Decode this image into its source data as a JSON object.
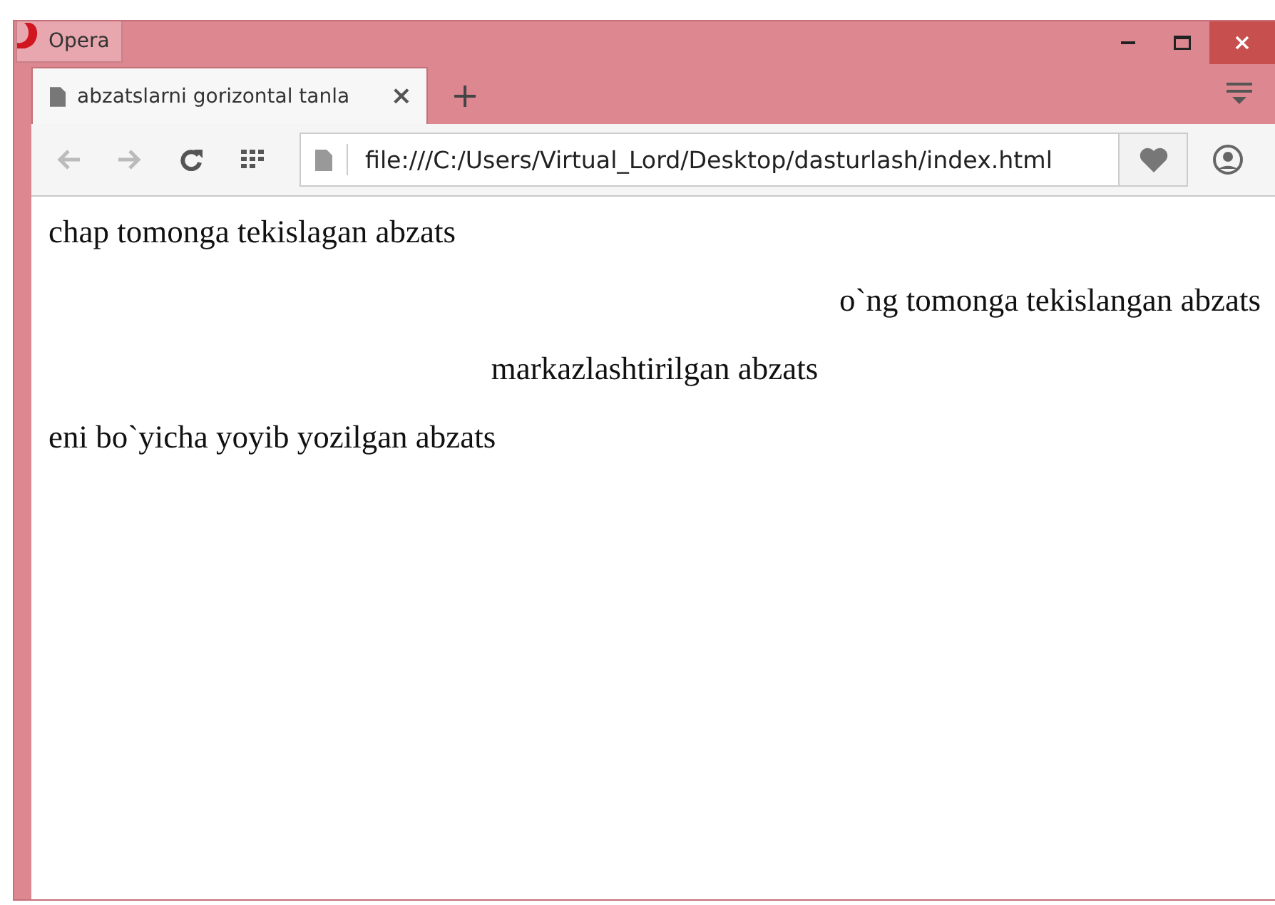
{
  "window": {
    "app_button": "Opera",
    "controls": [
      {
        "kind": "minimize"
      },
      {
        "kind": "maximize"
      },
      {
        "kind": "close"
      }
    ]
  },
  "tabs": [
    {
      "title": "abzatslarni gorizontal tanla",
      "selected": true,
      "close": "×"
    }
  ],
  "new_tab": "+",
  "address_bar": {
    "url": "file:///C:/Users/Virtual_Lord/Desktop/dasturlash/index.html"
  },
  "paragraphs": [
    {
      "text": "chap tomonga tekislagan abzats",
      "kind": "left"
    },
    {
      "text": "o`ng tomonga tekislangan abzats",
      "kind": "right"
    },
    {
      "text": "markazlashtirilgan abzats",
      "kind": "center"
    },
    {
      "text": "eni bo`yicha yoyib yozilgan abzats",
      "kind": "justify"
    }
  ]
}
